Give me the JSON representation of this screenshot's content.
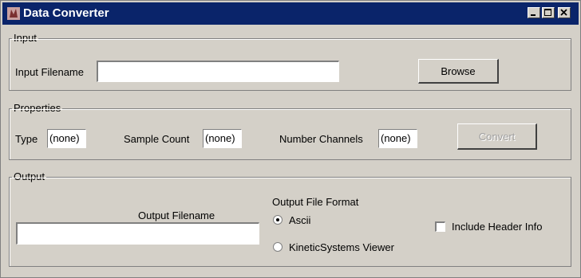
{
  "window": {
    "title": "Data Converter"
  },
  "input_group": {
    "legend": "Input",
    "filename_label": "Input Filename",
    "filename_value": "",
    "browse_label": "Browse"
  },
  "properties_group": {
    "legend": "Properties",
    "type_label": "Type",
    "type_value": "(none)",
    "sample_count_label": "Sample Count",
    "sample_count_value": "(none)",
    "channels_label": "Number Channels",
    "channels_value": "(none)",
    "convert_label": "Convert"
  },
  "output_group": {
    "legend": "Output",
    "filename_label": "Output Filename",
    "filename_value": "",
    "format_label": "Output File Format",
    "format_options": [
      "Ascii",
      "KineticSystems Viewer"
    ],
    "selected_format": "Ascii",
    "include_header_label": "Include Header Info",
    "include_header_checked": false
  },
  "colors": {
    "titlebar": "#0a246a",
    "window_bg": "#d4d0c8"
  }
}
